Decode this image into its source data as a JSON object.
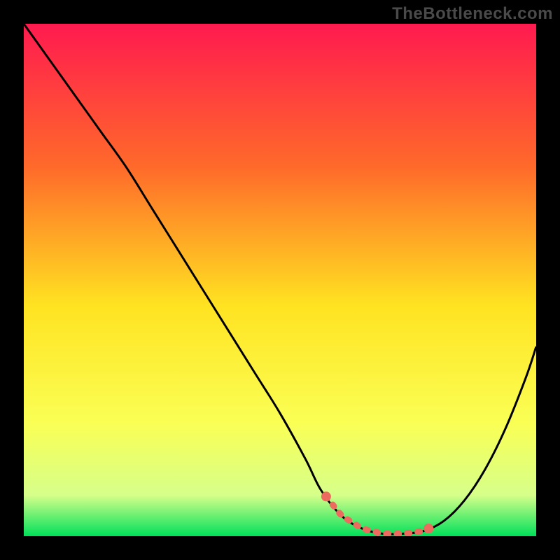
{
  "watermark": "TheBottleneck.com",
  "chart_data": {
    "type": "line",
    "title": "",
    "xlabel": "",
    "ylabel": "",
    "xrange": [
      0,
      100
    ],
    "yrange": [
      0,
      100
    ],
    "grid": false,
    "legend": false,
    "background_gradient": {
      "top": "#ff1a4f",
      "mid_upper": "#ff9a2a",
      "mid": "#ffe321",
      "lower": "#fbff6e",
      "bottom": "#00e05a"
    },
    "series": [
      {
        "name": "bottleneck-curve",
        "x": [
          0,
          5,
          10,
          15,
          20,
          25,
          30,
          35,
          40,
          45,
          50,
          55,
          58,
          62,
          66,
          70,
          74,
          78,
          82,
          86,
          90,
          94,
          98,
          100
        ],
        "y": [
          100,
          93,
          86,
          79,
          72,
          64,
          56,
          48,
          40,
          32,
          24,
          15,
          9,
          4,
          1.5,
          0.5,
          0.5,
          1.0,
          3,
          7,
          13,
          21,
          31,
          37
        ],
        "stroke": "#000000"
      }
    ],
    "highlight_band": {
      "name": "optimal-range",
      "x_start": 59,
      "x_end": 79,
      "y_approx": 1.8,
      "color": "#ec6b5e"
    }
  }
}
